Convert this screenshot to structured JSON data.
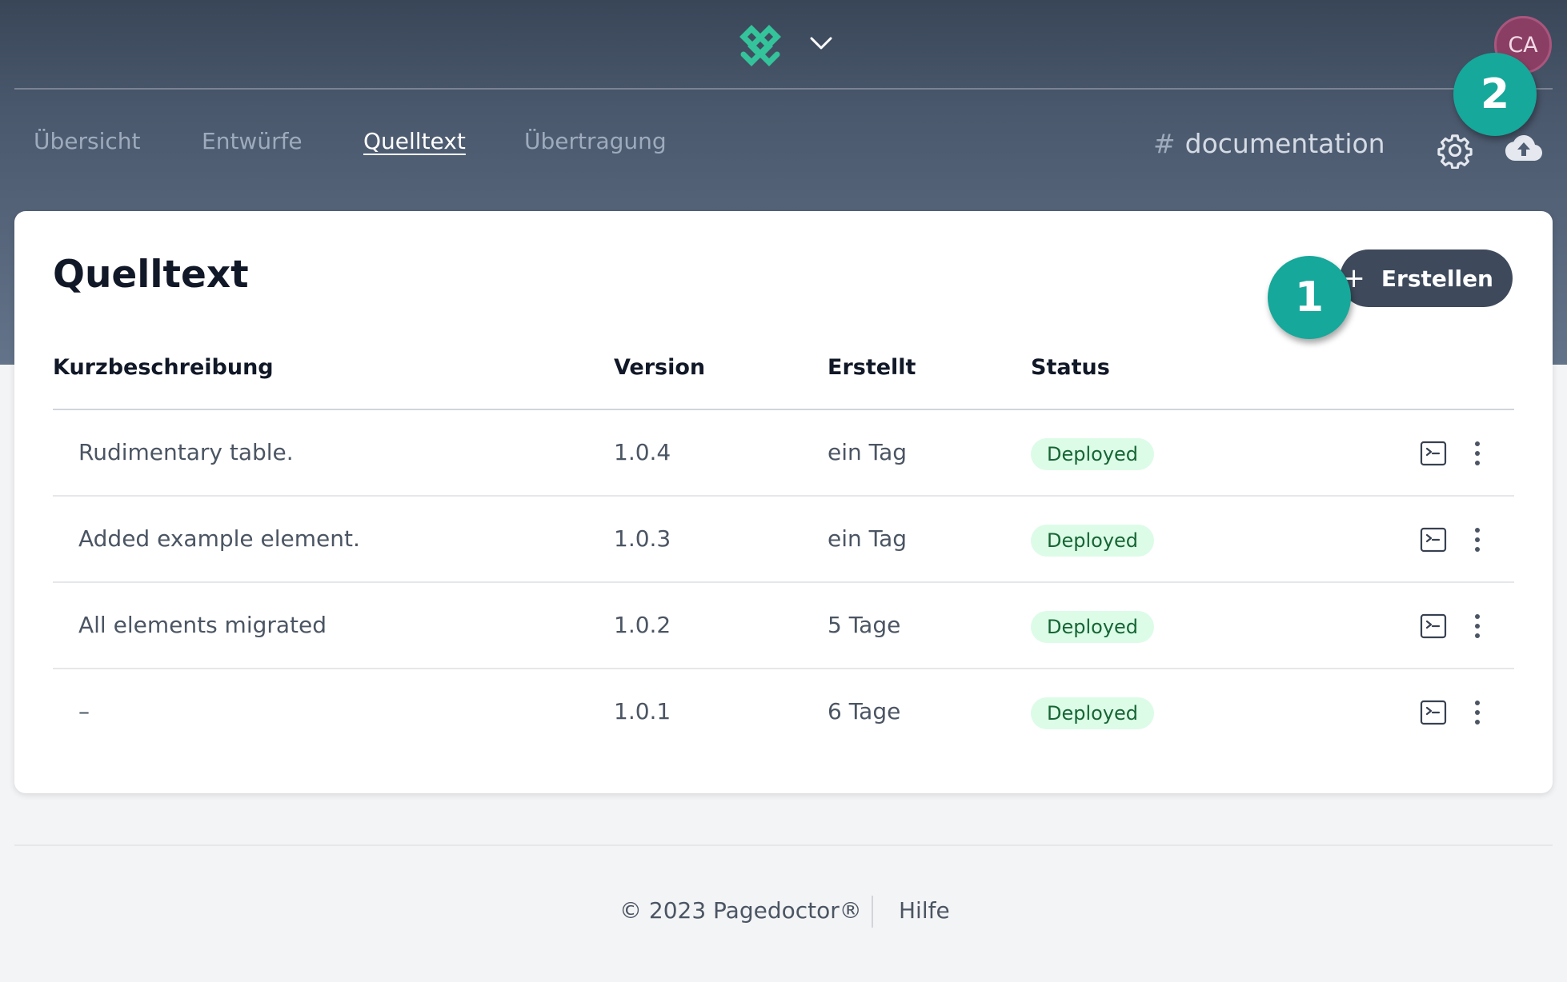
{
  "header": {
    "avatar_initials": "CA",
    "logo_icon": "pagedoctor-logo-icon",
    "accent_color": "#34c39a"
  },
  "nav": {
    "items": [
      {
        "label": "Übersicht",
        "active": false
      },
      {
        "label": "Entwürfe",
        "active": false
      },
      {
        "label": "Quelltext",
        "active": true
      },
      {
        "label": "Übertragung",
        "active": false
      }
    ],
    "repo_hash": "#",
    "repo_name": "documentation"
  },
  "markers": {
    "one": "1",
    "two": "2",
    "color": "#16a89a"
  },
  "main": {
    "title": "Quelltext",
    "create_button_label": "Erstellen",
    "columns": [
      "Kurzbeschreibung",
      "Version",
      "Erstellt",
      "Status"
    ],
    "rows": [
      {
        "description": "Rudimentary table.",
        "version": "1.0.4",
        "created": "ein Tag",
        "status": "Deployed"
      },
      {
        "description": "Added example element.",
        "version": "1.0.3",
        "created": "ein Tag",
        "status": "Deployed"
      },
      {
        "description": "All elements migrated",
        "version": "1.0.2",
        "created": "5 Tage",
        "status": "Deployed"
      },
      {
        "description": "–",
        "version": "1.0.1",
        "created": "6 Tage",
        "status": "Deployed"
      }
    ]
  },
  "footer": {
    "copyright": "© 2023 Pagedoctor®",
    "help_label": "Hilfe"
  }
}
